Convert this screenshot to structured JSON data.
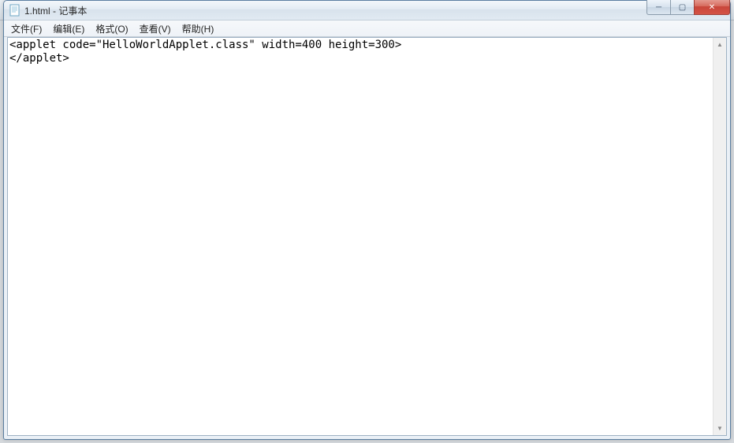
{
  "window": {
    "title": "1.html - 记事本"
  },
  "menubar": {
    "file": "文件(F)",
    "edit": "编辑(E)",
    "format": "格式(O)",
    "view": "查看(V)",
    "help": "帮助(H)"
  },
  "editor": {
    "content": "<applet code=\"HelloWorldApplet.class\" width=400 height=300>\n</applet>"
  },
  "window_controls": {
    "minimize_glyph": "─",
    "maximize_glyph": "▢",
    "close_glyph": "✕"
  },
  "scroll": {
    "up_glyph": "▲",
    "down_glyph": "▼"
  }
}
